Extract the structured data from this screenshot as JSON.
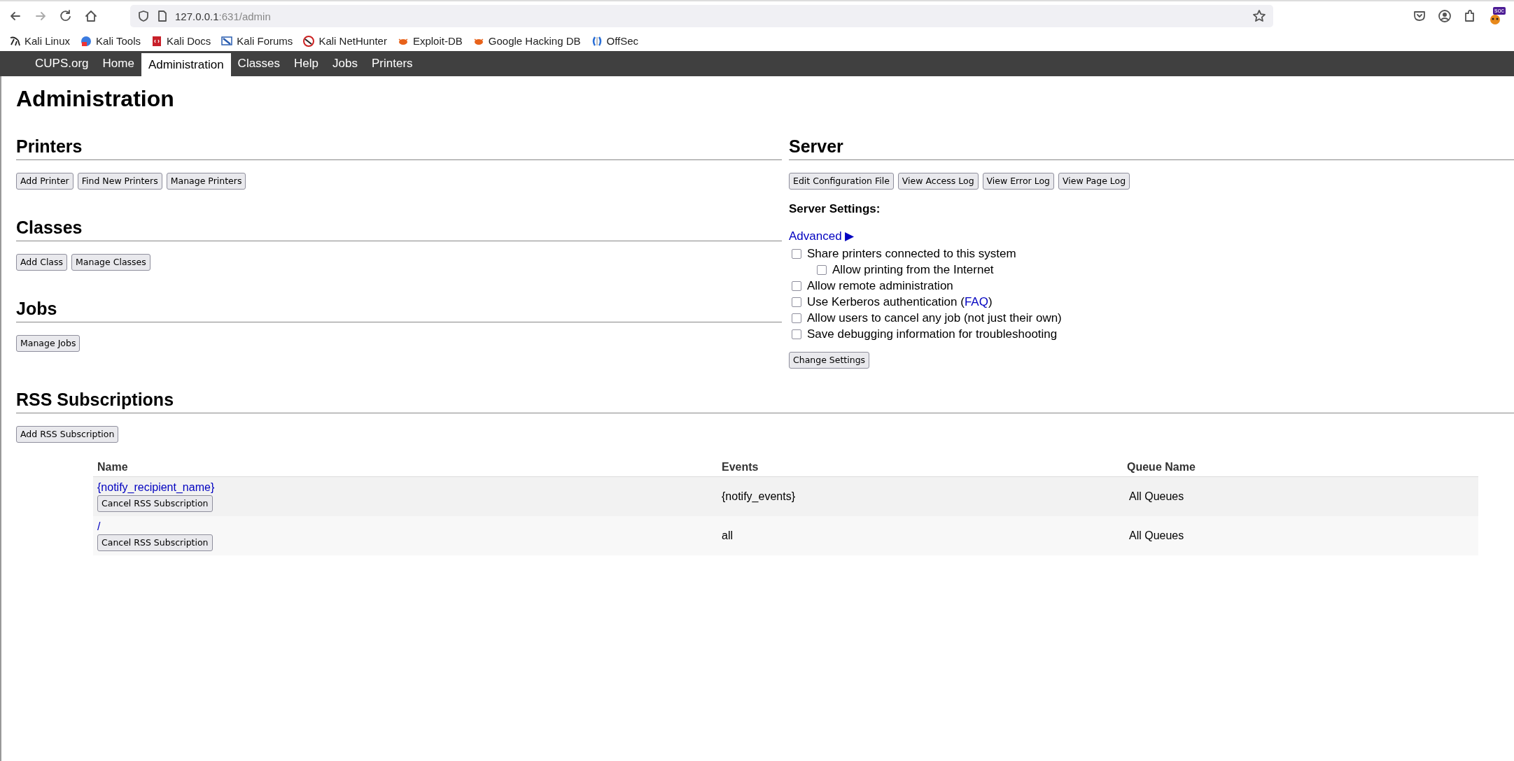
{
  "browser": {
    "url_host": "127.0.0.1",
    "url_path": ":631/admin",
    "extension_badge": "soc",
    "bookmarks": [
      {
        "label": "Kali Linux"
      },
      {
        "label": "Kali Tools"
      },
      {
        "label": "Kali Docs"
      },
      {
        "label": "Kali Forums"
      },
      {
        "label": "Kali NetHunter"
      },
      {
        "label": "Exploit-DB"
      },
      {
        "label": "Google Hacking DB"
      },
      {
        "label": "OffSec"
      }
    ]
  },
  "nav": [
    {
      "label": "CUPS.org",
      "selected": false
    },
    {
      "label": "Home",
      "selected": false
    },
    {
      "label": "Administration",
      "selected": true
    },
    {
      "label": "Classes",
      "selected": false
    },
    {
      "label": "Help",
      "selected": false
    },
    {
      "label": "Jobs",
      "selected": false
    },
    {
      "label": "Printers",
      "selected": false
    }
  ],
  "title": "Administration",
  "sections": [
    {
      "heading": "Printers",
      "buttons": [
        "Add Printer",
        "Find New Printers",
        "Manage Printers"
      ]
    },
    {
      "heading": "Classes",
      "buttons": [
        "Add Class",
        "Manage Classes"
      ]
    },
    {
      "heading": "Jobs",
      "buttons": [
        "Manage Jobs"
      ]
    }
  ],
  "server": {
    "heading": "Server",
    "buttons": [
      "Edit Configuration File",
      "View Access Log",
      "View Error Log",
      "View Page Log"
    ],
    "settings_title": "Server Settings:",
    "advanced_link": "Advanced ▶",
    "settings": [
      {
        "label": "Share printers connected to this system",
        "checked": false,
        "children": [
          {
            "label": "Allow printing from the Internet",
            "checked": false
          }
        ]
      },
      {
        "label": "Allow remote administration",
        "checked": false
      },
      {
        "label": "Use Kerberos authentication (",
        "link": "FAQ",
        "label_after": ")",
        "checked": false
      },
      {
        "label": "Allow users to cancel any job (not just their own)",
        "checked": false
      },
      {
        "label": "Save debugging information for troubleshooting",
        "checked": false
      }
    ],
    "submit": "Change Settings"
  },
  "rss": {
    "heading": "RSS Subscriptions",
    "buttons": [
      "Add RSS Subscription"
    ],
    "table": {
      "columns": [
        "Name",
        "Events",
        "Queue Name"
      ],
      "rows": [
        {
          "name": "{notify_recipient_name}",
          "action": "Cancel RSS Subscription",
          "events": "{notify_events}",
          "queue": "All Queues"
        },
        {
          "name": "/",
          "action": "Cancel RSS Subscription",
          "events": "all",
          "queue": "All Queues"
        }
      ]
    }
  }
}
